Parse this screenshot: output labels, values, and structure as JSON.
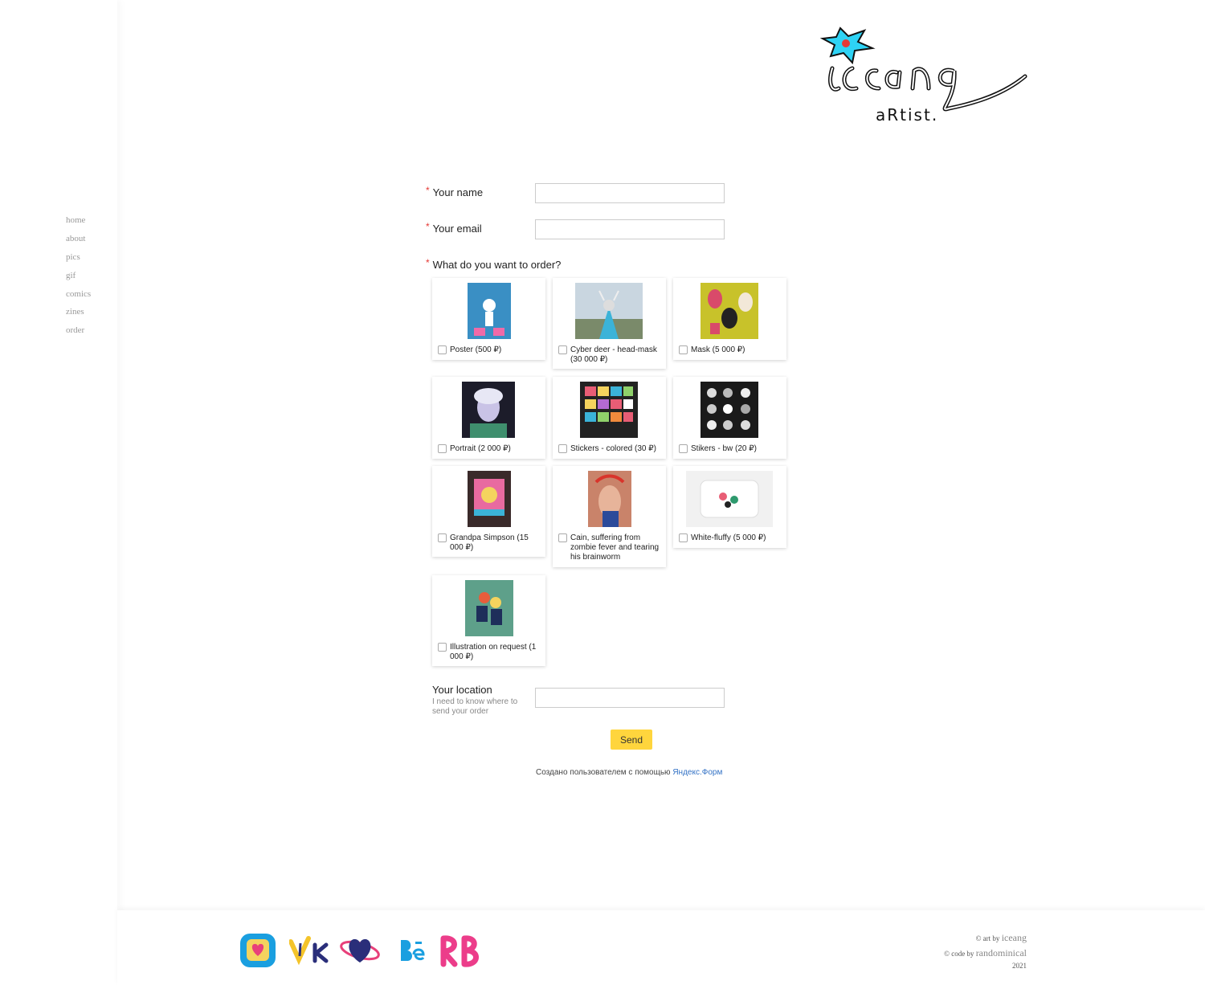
{
  "nav": [
    "home",
    "about",
    "pics",
    "gif",
    "comics",
    "zines",
    "order"
  ],
  "logo": {
    "word": "iceang",
    "sub": "artist."
  },
  "form": {
    "name_label": "Your name",
    "email_label": "Your email",
    "order_label": "What do you want to order?",
    "required_mark": "*",
    "items": [
      {
        "label": "Poster (500 ₽)"
      },
      {
        "label": "Cyber deer - head-mask (30 000 ₽)"
      },
      {
        "label": "Mask (5 000 ₽)"
      },
      {
        "label": "Portrait (2 000 ₽)"
      },
      {
        "label": "Stickers - colored (30 ₽)"
      },
      {
        "label": "Stikers - bw (20 ₽)"
      },
      {
        "label": "Grandpa Simpson (15 000 ₽)"
      },
      {
        "label": "Cain, suffering from zombie fever and tearing his brainworm"
      },
      {
        "label": "White-fluffy (5 000 ₽)"
      },
      {
        "label": "Illustration on request (1 000 ₽)"
      }
    ],
    "location_label": "Your location",
    "location_hint": "I need to know where to send your order",
    "send_label": "Send",
    "credit_text": "Создано пользователем с помощью ",
    "credit_link": "Яндекс.Форм"
  },
  "footer": {
    "social": [
      "kofi-icon",
      "vk-icon",
      "patreon-icon",
      "behance-icon",
      "redbubble-icon"
    ],
    "art_prefix": "© art by ",
    "art_name": "iceang",
    "code_prefix": "© code by ",
    "code_name": "randominical",
    "year": "2021"
  },
  "colors": {
    "accent": "#ffd53d",
    "required": "#e53935",
    "link": "#3372c5",
    "nav": "#999999"
  }
}
